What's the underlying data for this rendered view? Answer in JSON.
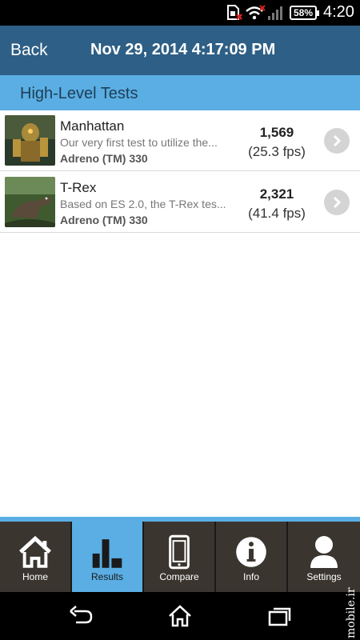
{
  "status_bar": {
    "battery": "58%",
    "time": "4:20",
    "icons": [
      "sim-error-icon",
      "wifi-icon",
      "signal-icon",
      "battery-icon"
    ]
  },
  "header": {
    "back_label": "Back",
    "date": "Nov 29, 2014 4:17:09 PM"
  },
  "section_title": "High-Level Tests",
  "tests": [
    {
      "name": "Manhattan",
      "description": "Our very first test to utilize the...",
      "gpu": "Adreno (TM) 330",
      "score": "1,569",
      "fps": "(25.3 fps)"
    },
    {
      "name": "T-Rex",
      "description": "Based on ES 2.0, the T-Rex tes...",
      "gpu": "Adreno (TM) 330",
      "score": "2,321",
      "fps": "(41.4 fps)"
    }
  ],
  "tabs": [
    {
      "label": "Home",
      "icon": "home-icon"
    },
    {
      "label": "Results",
      "icon": "bar-chart-icon",
      "active": true
    },
    {
      "label": "Compare",
      "icon": "phone-icon"
    },
    {
      "label": "Info",
      "icon": "info-icon"
    },
    {
      "label": "Settings",
      "icon": "user-icon"
    }
  ],
  "watermark": "mobile.ir",
  "colors": {
    "header": "#2e5f86",
    "accent": "#5aaee3",
    "tab_bg": "#3a352f"
  }
}
